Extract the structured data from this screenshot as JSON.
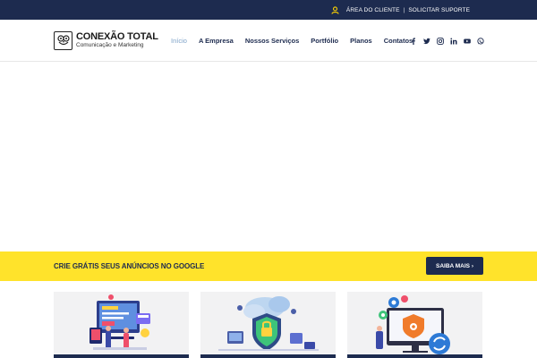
{
  "topbar": {
    "client_area": "ÁREA DO CLIENTE",
    "separator": "|",
    "support": "SOLICITAR SUPORTE",
    "icon": "user-icon",
    "icon_color": "#ffd400"
  },
  "logo": {
    "title": "CONEXÃO TOTAL",
    "subtitle": "Comunicação e Marketing"
  },
  "nav": {
    "items": [
      "Início",
      "A Empresa",
      "Nossos Serviços",
      "Portfólio",
      "Planos",
      "Contatos"
    ],
    "active_index": 0
  },
  "social": [
    "facebook-icon",
    "twitter-icon",
    "instagram-icon",
    "linkedin-icon",
    "youtube-icon",
    "whatsapp-icon"
  ],
  "promo": {
    "text": "CRIE GRÁTIS SEUS ANÚNCIOS NO GOOGLE",
    "button": "SAIBA MAIS ›"
  },
  "cards": [
    {
      "icon": "web-design-illustration"
    },
    {
      "icon": "security-cloud-illustration"
    },
    {
      "icon": "maintenance-update-illustration"
    }
  ],
  "colors": {
    "navy": "#1d2b4f",
    "yellow": "#ffe32b",
    "active_link": "#7fa3c9",
    "card_bg": "#f2f2f3"
  }
}
